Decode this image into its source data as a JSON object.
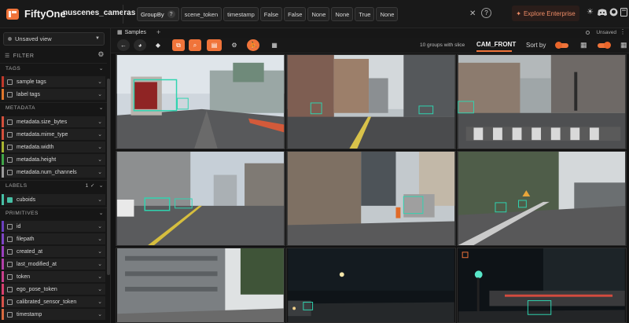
{
  "app": {
    "brand": "FiftyOne",
    "dataset_name": "nuscenes_cameras"
  },
  "view_bar": {
    "stages": [
      {
        "label": "GroupBy",
        "strong": true
      },
      {
        "label": "scene_token"
      },
      {
        "label": "timestamp"
      },
      {
        "label": "False"
      },
      {
        "label": "False"
      },
      {
        "label": "None"
      },
      {
        "label": "None"
      },
      {
        "label": "True"
      },
      {
        "label": "None"
      }
    ],
    "help_glyph": "?"
  },
  "header": {
    "explore_label": "Explore Enterprise",
    "icons": [
      "sun-icon",
      "discord-icon",
      "github-icon",
      "book-icon"
    ]
  },
  "sidebar": {
    "view_select": "Unsaved view",
    "filter_label": "FILTER",
    "sections": {
      "tags": "TAGS",
      "metadata": "METADATA",
      "labels": "LABELS",
      "primitives": "PRIMITIVES"
    },
    "labels_count": "1",
    "tag_items": [
      {
        "label": "sample tags",
        "color": "#c0392b"
      },
      {
        "label": "label tags",
        "color": "#e0772c"
      }
    ],
    "metadata_items": [
      {
        "label": "metadata.size_bytes",
        "color": "#d3503c"
      },
      {
        "label": "metadata.mime_type",
        "color": "#d3503c"
      },
      {
        "label": "metadata.width",
        "color": "#a8b531"
      },
      {
        "label": "metadata.height",
        "color": "#3fa548"
      },
      {
        "label": "metadata.num_channels",
        "color": "#9a9a9a"
      }
    ],
    "label_items": [
      {
        "label": "cuboids",
        "color": "#47bfa5",
        "checked": true
      }
    ],
    "primitive_items": [
      {
        "label": "id",
        "color": "#6b3fbf"
      },
      {
        "label": "filepath",
        "color": "#7d45c4"
      },
      {
        "label": "created_at",
        "color": "#9a3fbf"
      },
      {
        "label": "last_modified_at",
        "color": "#b23fa8"
      },
      {
        "label": "token",
        "color": "#c93f8c"
      },
      {
        "label": "ego_pose_token",
        "color": "#d83f6e"
      },
      {
        "label": "calibrated_sensor_token",
        "color": "#d8534a"
      },
      {
        "label": "timestamp",
        "color": "#d86a3f"
      }
    ]
  },
  "tabs": {
    "samples_label": "Samples",
    "add_label": "+",
    "unsaved_label": "Unsaved"
  },
  "toolbar": {
    "groups_text": "10 groups with slice",
    "slice": "CAM_FRONT",
    "sort_label": "Sort by"
  }
}
